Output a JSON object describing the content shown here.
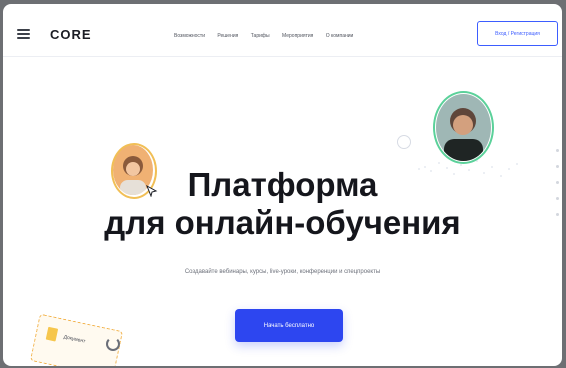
{
  "header": {
    "logo": "CORE",
    "nav": [
      "Возможности",
      "Решения",
      "Тарифы",
      "Мероприятия",
      "О компании"
    ],
    "login_button": "Вход / Регистрация"
  },
  "hero": {
    "title_line1": "Платформа",
    "title_line2": "для онлайн-обучения",
    "subtitle": "Создавайте вебинары, курсы, live-уроки, конференции и спецпроекты",
    "cta": "Начать бесплатно"
  },
  "decor": {
    "doc_label": "Документ"
  },
  "colors": {
    "accent": "#2d46f0",
    "ring": "#5bd19a",
    "background": "#ffffff"
  }
}
